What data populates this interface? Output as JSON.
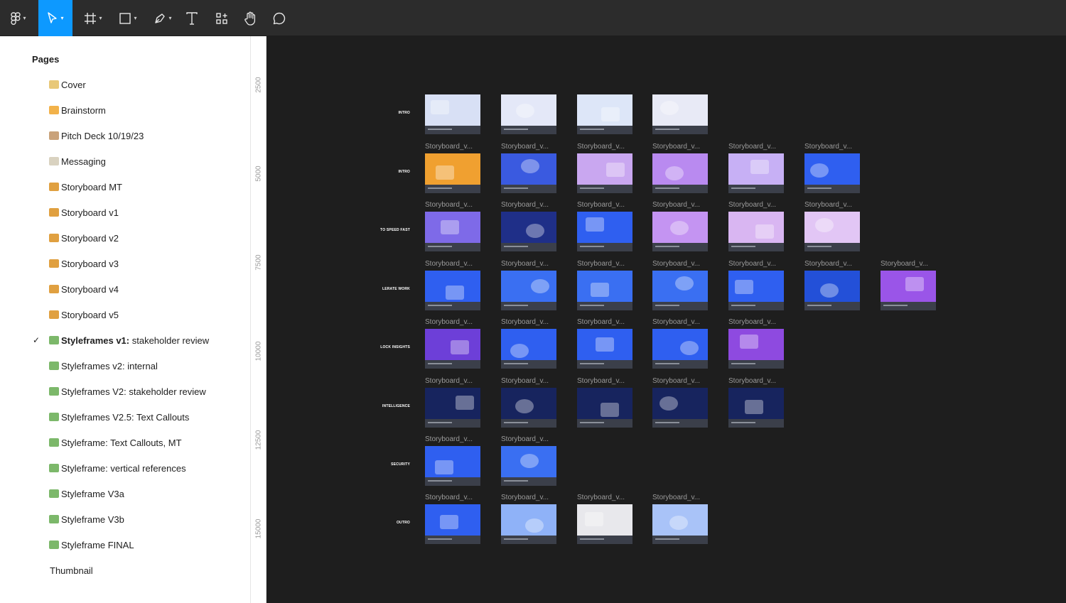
{
  "toolbar": {
    "tools": [
      {
        "name": "main-menu",
        "icon": "figma-logo-icon",
        "has_caret": true
      },
      {
        "name": "move-tool",
        "icon": "cursor-arrow-icon",
        "has_caret": true,
        "active": true
      },
      {
        "name": "frame-tool",
        "icon": "frame-hash-icon",
        "has_caret": true
      },
      {
        "name": "shape-tool",
        "icon": "rectangle-icon",
        "has_caret": true
      },
      {
        "name": "pen-tool",
        "icon": "pen-icon",
        "has_caret": true
      },
      {
        "name": "text-tool",
        "icon": "text-icon",
        "has_caret": false
      },
      {
        "name": "resources-tool",
        "icon": "components-icon",
        "has_caret": false
      },
      {
        "name": "hand-tool",
        "icon": "hand-icon",
        "has_caret": false
      },
      {
        "name": "comment-tool",
        "icon": "comment-bubble-icon",
        "has_caret": false
      }
    ],
    "accent": "#0d99ff"
  },
  "sidebar": {
    "title": "Pages",
    "pages": [
      {
        "label": "Cover",
        "emoji_color": "#e8c878"
      },
      {
        "label": "Brainstorm",
        "emoji_color": "#f2b24a"
      },
      {
        "label": "Pitch Deck 10/19/23",
        "emoji_color": "#c9a27a"
      },
      {
        "label": "Messaging",
        "emoji_color": "#d9d2c0"
      },
      {
        "label": "Storyboard MT",
        "emoji_color": "#e0a040"
      },
      {
        "label": "Storyboard v1",
        "emoji_color": "#e0a040"
      },
      {
        "label": "Storyboard v2",
        "emoji_color": "#e0a040"
      },
      {
        "label": "Storyboard v3",
        "emoji_color": "#e0a040"
      },
      {
        "label": "Storyboard v4",
        "emoji_color": "#e0a040"
      },
      {
        "label": "Storyboard v5",
        "emoji_color": "#e0a040"
      },
      {
        "label_bold": "Styleframes v1:",
        "label_rest": " stakeholder review",
        "emoji_color": "#7cb86a",
        "selected": true
      },
      {
        "label": "Styleframes v2: internal",
        "emoji_color": "#7cb86a"
      },
      {
        "label": "Styleframes V2: stakeholder review",
        "emoji_color": "#7cb86a"
      },
      {
        "label": "Styleframes V2.5: Text Callouts",
        "emoji_color": "#7cb86a"
      },
      {
        "label": "Styleframe: Text Callouts, MT",
        "emoji_color": "#7cb86a"
      },
      {
        "label": "Styleframe: vertical references",
        "emoji_color": "#7cb86a"
      },
      {
        "label": "Styleframe V3a",
        "emoji_color": "#7cb86a"
      },
      {
        "label": "Styleframe V3b",
        "emoji_color": "#7cb86a"
      },
      {
        "label": "Styleframe FINAL",
        "emoji_color": "#7cb86a"
      },
      {
        "label": "Thumbnail",
        "emoji_color": null
      }
    ],
    "check_glyph": "✓"
  },
  "ruler": {
    "ticks": [
      "2500",
      "5000",
      "7500",
      "10000",
      "12500",
      "15000"
    ]
  },
  "canvas": {
    "frame_label": "Storyboard_v...",
    "rows": [
      {
        "section": "INTRO",
        "labels": false,
        "frames": [
          "#d8e0f5",
          "#e4e8f8",
          "#dde6f8",
          "#e8eaf6"
        ]
      },
      {
        "section": "INTRO",
        "labels": true,
        "frames": [
          "#f0a030",
          "#3a5ae0",
          "#c9a7f0",
          "#b98af0",
          "#c7b0f5",
          "#2f5ff0"
        ]
      },
      {
        "section": "TO SPEED FAST",
        "labels": true,
        "frames": [
          "#7e6ae8",
          "#1f2f88",
          "#2f5ff0",
          "#c494f2",
          "#d9b6f2",
          "#e2c6f5"
        ]
      },
      {
        "section": "LERATE WORK",
        "labels": true,
        "frames": [
          "#2f5ff0",
          "#3a6ff2",
          "#3a6ff2",
          "#3a6ff2",
          "#2f5ff0",
          "#2350d8",
          "#9a55e8"
        ]
      },
      {
        "section": "LOCK INSIGHTS",
        "labels": true,
        "frames": [
          "#6d3fd8",
          "#2f5ff0",
          "#2f5ff0",
          "#2f5ff0",
          "#8e4ae0"
        ]
      },
      {
        "section": "INTELLIGENCE",
        "labels": true,
        "frames": [
          "#17245e",
          "#17245e",
          "#17245e",
          "#17245e",
          "#17245e"
        ]
      },
      {
        "section": "SECURITY",
        "labels": true,
        "frames": [
          "#2f5ff0",
          "#3a6ff2"
        ]
      },
      {
        "section": "OUTRO",
        "labels": true,
        "frames": [
          "#2f5ff0",
          "#8fb2f8",
          "#e8e8ec",
          "#a9c3f8"
        ]
      }
    ]
  }
}
